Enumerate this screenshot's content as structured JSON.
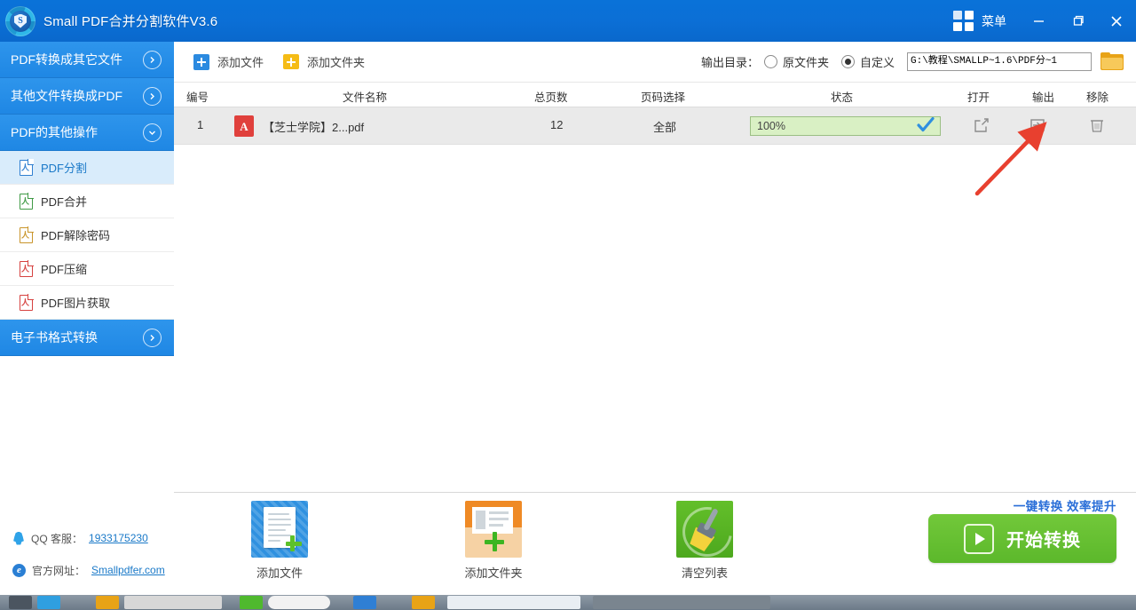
{
  "titlebar": {
    "app_title": "Small PDF合并分割软件V3.6",
    "menu_label": "菜单",
    "logo_letter": "S",
    "minimize": "−",
    "restore": "❐",
    "close": "✕"
  },
  "sidebar": {
    "groups": [
      {
        "label": "PDF转换成其它文件",
        "expanded": false
      },
      {
        "label": "其他文件转换成PDF",
        "expanded": false
      },
      {
        "label": "PDF的其他操作",
        "expanded": true
      }
    ],
    "items": [
      {
        "label": "PDF分割",
        "color": "#2f7fd0",
        "active": true
      },
      {
        "label": "PDF合并",
        "color": "#3f9a45",
        "active": false
      },
      {
        "label": "PDF解除密码",
        "color": "#c9952b",
        "active": false
      },
      {
        "label": "PDF压缩",
        "color": "#d6413f",
        "active": false
      },
      {
        "label": "PDF图片获取",
        "color": "#d6413f",
        "active": false
      }
    ],
    "last_group": {
      "label": "电子书格式转换",
      "expanded": false
    }
  },
  "contact": {
    "qq_label": "QQ 客服：",
    "qq_value": "1933175230",
    "site_label": "官方网址：",
    "site_value": "Smallpdfer.com"
  },
  "toolbar": {
    "add_file": "添加文件",
    "add_folder": "添加文件夹",
    "output_dir_label": "输出目录：",
    "option_source": "原文件夹",
    "option_custom": "自定义",
    "selected_option": "自定义",
    "path_value": "G:\\教程\\SMALLP~1.6\\PDF分~1"
  },
  "table": {
    "headers": [
      "编号",
      "文件名称",
      "总页数",
      "页码选择",
      "状态",
      "打开",
      "输出",
      "移除"
    ],
    "rows": [
      {
        "index": "1",
        "filename": "【芝士学院】2...pdf",
        "file_badge": "A",
        "pages": "12",
        "page_select": "全部",
        "status": "100%",
        "status_done": true
      }
    ]
  },
  "bottom": {
    "actions": [
      {
        "label": "添加文件",
        "icon": "add-file-icon"
      },
      {
        "label": "添加文件夹",
        "icon": "add-folder-icon"
      },
      {
        "label": "清空列表",
        "icon": "clear-list-icon"
      }
    ],
    "promo": "一键转换  效率提升",
    "start_label": "开始转换"
  },
  "colors": {
    "title_blue": "#0b6fd6",
    "sidebar_blue": "#2288e6",
    "active_item": "#d9ecfb",
    "progress_green": "#d9f0c4",
    "start_green": "#5cb82b",
    "accent_link": "#1a79c8",
    "arrow_red": "#e8402f"
  }
}
